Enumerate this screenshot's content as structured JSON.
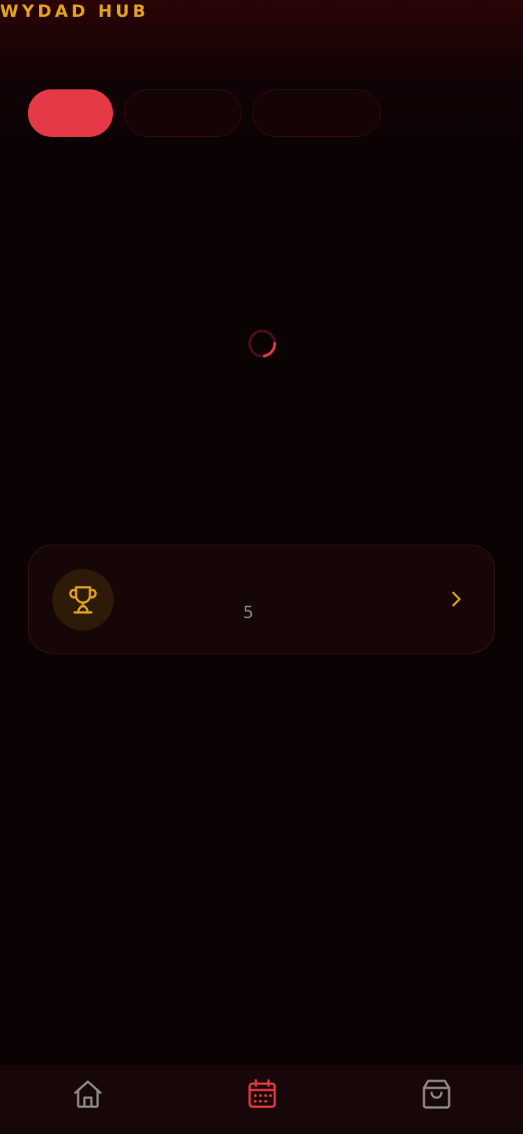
{
  "header": {
    "title": "WYDAD HUB"
  },
  "tabs": [
    {
      "label": "",
      "active": true
    },
    {
      "label": "",
      "active": false
    },
    {
      "label": "",
      "active": false
    }
  ],
  "card": {
    "count": "5",
    "icon": "trophy-icon"
  },
  "bottom_nav": [
    {
      "icon": "home-icon",
      "active": false
    },
    {
      "icon": "calendar-icon",
      "active": true
    },
    {
      "icon": "shopping-bag-icon",
      "active": false
    }
  ],
  "colors": {
    "accent": "#e63946",
    "gold": "#e3a51d"
  }
}
